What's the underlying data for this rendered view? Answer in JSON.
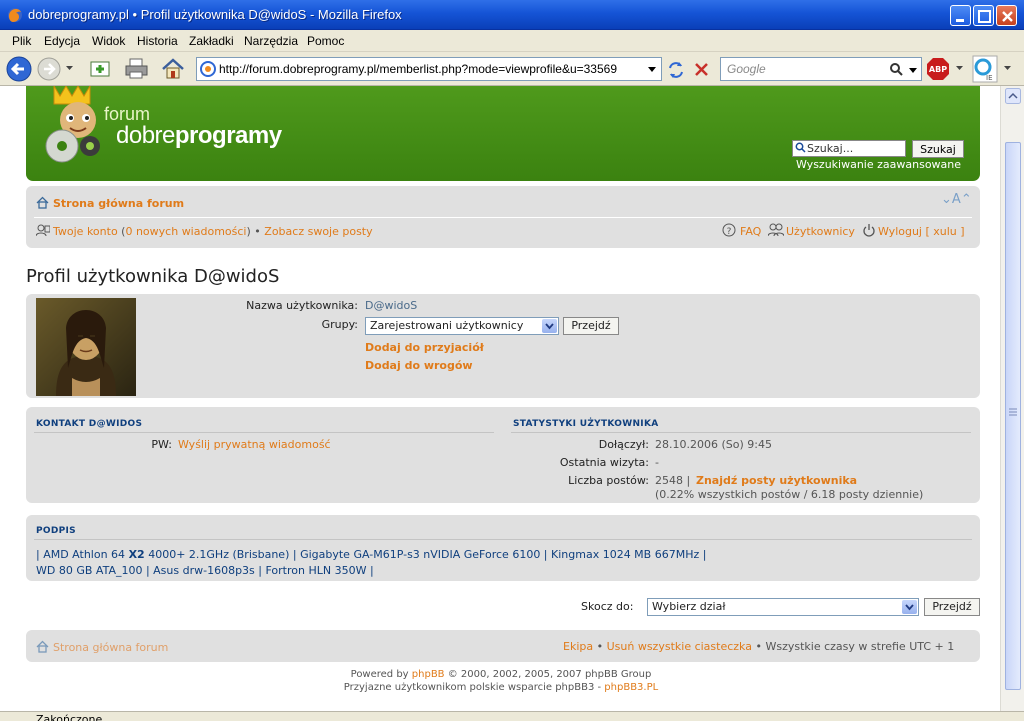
{
  "window": {
    "title": "dobreprogramy.pl • Profil użytkownika D@widoS - Mozilla Firefox"
  },
  "menu": [
    "Plik",
    "Edycja",
    "Widok",
    "Historia",
    "Zakładki",
    "Narzędzia",
    "Pomoc"
  ],
  "navbar": {
    "url": "http://forum.dobreprogramy.pl/memberlist.php?mode=viewprofile&u=33569",
    "search_placeholder": "Google"
  },
  "status": {
    "text": "Zakończone"
  },
  "header": {
    "logo_forum": "forum",
    "logo_name_a": "dobre",
    "logo_name_b": "programy",
    "search_placeholder": "Szukaj...",
    "search_button": "Szukaj",
    "advanced": "Wyszukiwanie zaawansowane"
  },
  "navpanel": {
    "home": "Strona główna forum",
    "font_size": "A",
    "account": "Twoje konto",
    "new_msgs_open": "(",
    "new_msgs_count": "0",
    "new_msgs_text": " nowych wiadomości",
    "new_msgs_close": ")",
    "bullet": "•",
    "my_posts": "Zobacz swoje posty",
    "faq": "FAQ",
    "users": "Użytkownicy",
    "logout": "Wyloguj [ xulu ]"
  },
  "profile": {
    "title": "Profil użytkownika D@widoS",
    "username_label": "Nazwa użytkownika:",
    "username": "D@widoS",
    "groups_label": "Grupy:",
    "group_value": "Zarejestrowani użytkownicy",
    "go_button": "Przejdź",
    "add_friend": "Dodaj do przyjaciół",
    "add_foe": "Dodaj do wrogów"
  },
  "contact": {
    "heading": "KONTAKT D@WIDOS",
    "pw_label": "PW:",
    "pw_link": "Wyślij prywatną wiadomość"
  },
  "stats": {
    "heading": "STATYSTYKI UŻYTKOWNIKA",
    "joined_label": "Dołączył:",
    "joined": "28.10.2006 (So) 9:45",
    "last_label": "Ostatnia wizyta:",
    "last": "-",
    "posts_label": "Liczba postów:",
    "posts": "2548 |",
    "find_posts": "Znajdź posty użytkownika",
    "posts_detail": "(0.22% wszystkich postów / 6.18 posty dziennie)"
  },
  "signature": {
    "heading": "PODPIS",
    "line1_a": "| AMD Athlon 64 ",
    "line1_b": "X2",
    "line1_c": " 4000+ 2.1GHz (Brisbane) | Gigabyte GA-M61P-s3 nVIDIA GeForce 6100 | Kingmax 1024 MB 667MHz |",
    "line2": "WD 80 GB ATA_100 | Asus drw-1608p3s | Fortron HLN 350W |"
  },
  "jump": {
    "label": "Skocz do:",
    "value": "Wybierz dział",
    "button": "Przejdź"
  },
  "footerpanel": {
    "home": "Strona główna forum",
    "team": "Ekipa",
    "bullet": "•",
    "cookies": "Usuń wszystkie ciasteczka",
    "timezone": "Wszystkie czasy w strefie UTC + 1"
  },
  "footer": {
    "powered_a": "Powered by ",
    "powered_link": "phpBB",
    "powered_b": " © 2000, 2002, 2005, 2007 phpBB Group",
    "support_a": "Przyjazne użytkownikom polskie wsparcie phpBB3 - ",
    "support_link": "phpBB3.PL"
  }
}
